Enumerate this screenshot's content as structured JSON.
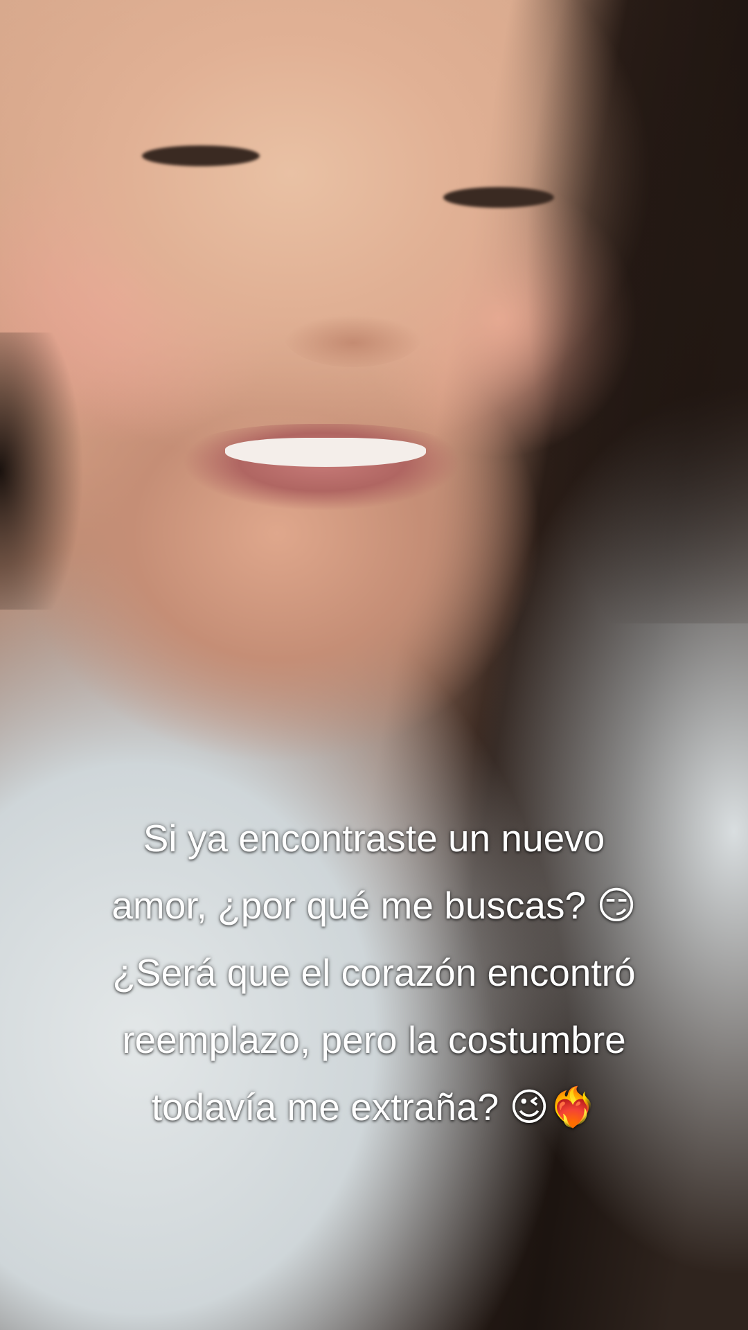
{
  "caption": {
    "lines": [
      "Si ya encontraste un nuevo",
      "amor, ¿por qué me buscas? 😏",
      "¿Será que el corazón encontró",
      "reemplazo, pero la costumbre",
      "todavía me extraña? 😉❤️‍🔥"
    ]
  },
  "colors": {
    "caption_text": "#ffffff",
    "shirt": "#d9dee0",
    "hair": "#1c1410"
  }
}
